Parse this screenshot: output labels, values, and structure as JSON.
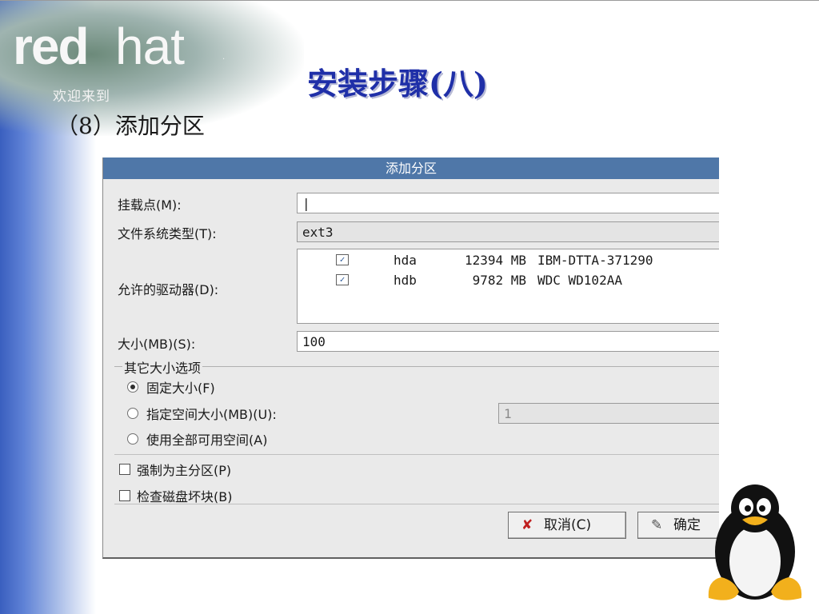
{
  "slide": {
    "logo_red": "red",
    "logo_hat": "hat",
    "logo_tm": ".",
    "welcome": "欢迎来到",
    "title": "安装步骤(八)",
    "subtitle": "（8）添加分区"
  },
  "dialog": {
    "title": "添加分区",
    "mount_label": "挂载点(M):",
    "mount_value": "|",
    "fstype_label": "文件系统类型(T):",
    "fstype_value": "ext3",
    "drives_label": "允许的驱动器(D):",
    "drives": [
      {
        "checked": true,
        "name": "hda",
        "size": "12394 MB",
        "model": "IBM-DTTA-371290"
      },
      {
        "checked": true,
        "name": "hdb",
        "size": "9782 MB",
        "model": "WDC WD102AA"
      }
    ],
    "size_label": "大小(MB)(S):",
    "size_value": "100",
    "other_options_title": "其它大小选项",
    "radio_fixed": "固定大小(F)",
    "radio_maxsize": "指定空间大小(MB)(U):",
    "maxsize_value": "1",
    "radio_fill": "使用全部可用空间(A)",
    "checkbox_primary": "强制为主分区(P)",
    "checkbox_badblocks": "检查磁盘坏块(B)",
    "cancel_label": "取消(C)",
    "ok_label": "确定",
    "selected_radio": "fixed"
  },
  "colors": {
    "titlebar": "#4f77a8",
    "slide_title": "#1f2fa8",
    "dialog_bg": "#eaeaea"
  },
  "icons": {
    "cancel": "close-x-icon",
    "ok": "ok-icon",
    "check": "checkmark-icon",
    "mascot": "tux-penguin-icon"
  }
}
